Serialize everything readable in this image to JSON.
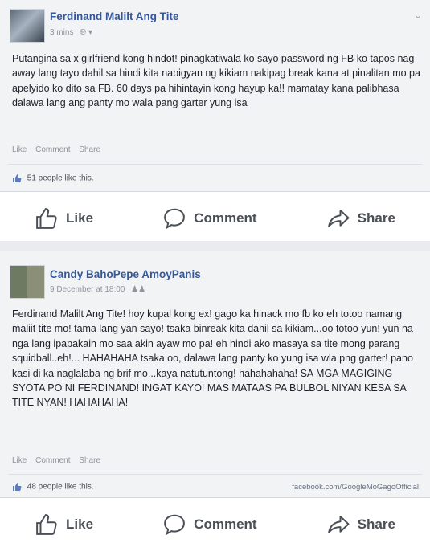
{
  "posts": [
    {
      "author": "Ferdinand Malilt Ang Tite",
      "time": "3 mins",
      "privacy_icon": "globe-icon",
      "text": "Putangina sa x girlfriend kong hindot! pinagkatiwala ko sayo password ng FB ko tapos nag away lang tayo dahil sa hindi kita nabigyan ng kikiam nakipag break kana at pinalitan mo pa apelyido ko dito sa FB. 60 days pa hihintayin kong hayup ka!! mamatay kana palibhasa dalawa lang ang panty mo wala pang garter yung isa",
      "actions": [
        "Like",
        "Comment",
        "Share"
      ],
      "likes": "51 people like this.",
      "bar": {
        "like": "Like",
        "comment": "Comment",
        "share": "Share"
      }
    },
    {
      "author": "Candy BahoPepe AmoyPanis",
      "time": "9 December at 18:00",
      "privacy_icon": "friends-icon",
      "text": "Ferdinand Malilt Ang Tite! hoy kupal kong ex! gago ka hinack mo fb ko eh totoo namang maliit tite mo! tama lang yan sayo! tsaka binreak kita dahil sa kikiam...oo totoo yun! yun na nga lang ipapakain mo saa akin ayaw mo pa! eh hindi ako masaya sa tite mong parang squidball..eh!... HAHAHAHA tsaka oo, dalawa lang panty ko yung isa wla png garter! pano kasi di ka naglalaba ng brif mo...kaya natutuntong! hahahahaha! SA MGA MAGIGING SYOTA PO NI FERDINAND! INGAT KAYO! MAS MATAAS PA BULBOL NIYAN KESA SA TITE NYAN! HAHAHAHA!",
      "actions": [
        "Like",
        "Comment",
        "Share"
      ],
      "likes": "48 people like this.",
      "watermark": "facebook.com/GoogleMoGagoOfficial",
      "bar": {
        "like": "Like",
        "comment": "Comment",
        "share": "Share"
      }
    }
  ],
  "colors": {
    "author": "#365899",
    "meta": "#90949c",
    "text": "#1d2129",
    "like_blue": "#5b7bc0"
  }
}
